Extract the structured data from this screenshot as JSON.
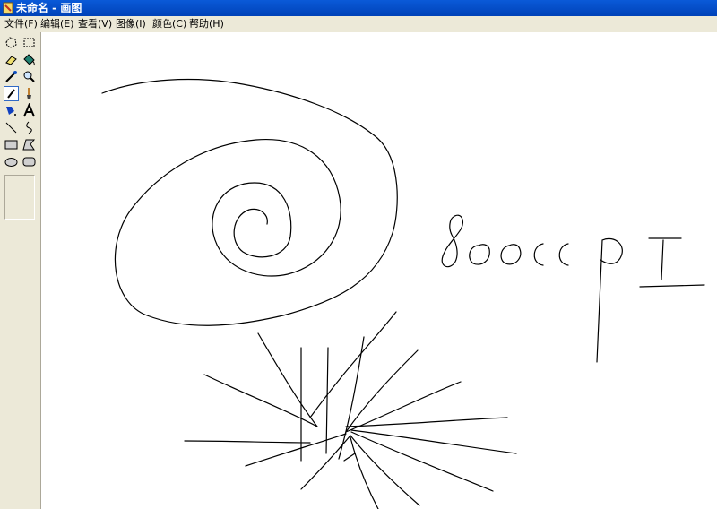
{
  "window": {
    "title": "未命名 - 画图"
  },
  "menu": [
    {
      "label": "文件(F)"
    },
    {
      "label": "编辑(E)"
    },
    {
      "label": "查看(V)"
    },
    {
      "label": "图像(I)"
    },
    {
      "label": "颜色(C)"
    },
    {
      "label": "帮助(H)"
    }
  ],
  "tools": [
    {
      "icon": "free-select-icon"
    },
    {
      "icon": "rect-select-icon"
    },
    {
      "icon": "eraser-icon"
    },
    {
      "icon": "fill-bucket-icon"
    },
    {
      "icon": "color-picker-icon"
    },
    {
      "icon": "magnifier-icon"
    },
    {
      "icon": "pencil-icon",
      "active": true
    },
    {
      "icon": "brush-icon"
    },
    {
      "icon": "airbrush-icon"
    },
    {
      "icon": "text-icon",
      "glyph": "A"
    },
    {
      "icon": "line-icon"
    },
    {
      "icon": "curve-icon"
    },
    {
      "icon": "rectangle-icon"
    },
    {
      "icon": "polygon-icon"
    },
    {
      "icon": "ellipse-icon"
    },
    {
      "icon": "rounded-rectangle-icon"
    }
  ],
  "colors": {
    "titlebar": "#0a5ad8",
    "chrome": "#ece9d8",
    "canvas": "#ffffff",
    "ink": "#000000"
  }
}
